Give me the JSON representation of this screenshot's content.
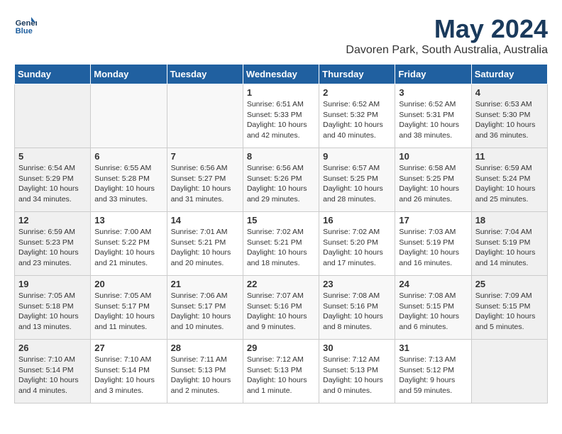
{
  "header": {
    "logo_line1": "General",
    "logo_line2": "Blue",
    "month_title": "May 2024",
    "location": "Davoren Park, South Australia, Australia"
  },
  "weekdays": [
    "Sunday",
    "Monday",
    "Tuesday",
    "Wednesday",
    "Thursday",
    "Friday",
    "Saturday"
  ],
  "weeks": [
    [
      {
        "day": "",
        "info": ""
      },
      {
        "day": "",
        "info": ""
      },
      {
        "day": "",
        "info": ""
      },
      {
        "day": "1",
        "info": "Sunrise: 6:51 AM\nSunset: 5:33 PM\nDaylight: 10 hours\nand 42 minutes."
      },
      {
        "day": "2",
        "info": "Sunrise: 6:52 AM\nSunset: 5:32 PM\nDaylight: 10 hours\nand 40 minutes."
      },
      {
        "day": "3",
        "info": "Sunrise: 6:52 AM\nSunset: 5:31 PM\nDaylight: 10 hours\nand 38 minutes."
      },
      {
        "day": "4",
        "info": "Sunrise: 6:53 AM\nSunset: 5:30 PM\nDaylight: 10 hours\nand 36 minutes."
      }
    ],
    [
      {
        "day": "5",
        "info": "Sunrise: 6:54 AM\nSunset: 5:29 PM\nDaylight: 10 hours\nand 34 minutes."
      },
      {
        "day": "6",
        "info": "Sunrise: 6:55 AM\nSunset: 5:28 PM\nDaylight: 10 hours\nand 33 minutes."
      },
      {
        "day": "7",
        "info": "Sunrise: 6:56 AM\nSunset: 5:27 PM\nDaylight: 10 hours\nand 31 minutes."
      },
      {
        "day": "8",
        "info": "Sunrise: 6:56 AM\nSunset: 5:26 PM\nDaylight: 10 hours\nand 29 minutes."
      },
      {
        "day": "9",
        "info": "Sunrise: 6:57 AM\nSunset: 5:25 PM\nDaylight: 10 hours\nand 28 minutes."
      },
      {
        "day": "10",
        "info": "Sunrise: 6:58 AM\nSunset: 5:25 PM\nDaylight: 10 hours\nand 26 minutes."
      },
      {
        "day": "11",
        "info": "Sunrise: 6:59 AM\nSunset: 5:24 PM\nDaylight: 10 hours\nand 25 minutes."
      }
    ],
    [
      {
        "day": "12",
        "info": "Sunrise: 6:59 AM\nSunset: 5:23 PM\nDaylight: 10 hours\nand 23 minutes."
      },
      {
        "day": "13",
        "info": "Sunrise: 7:00 AM\nSunset: 5:22 PM\nDaylight: 10 hours\nand 21 minutes."
      },
      {
        "day": "14",
        "info": "Sunrise: 7:01 AM\nSunset: 5:21 PM\nDaylight: 10 hours\nand 20 minutes."
      },
      {
        "day": "15",
        "info": "Sunrise: 7:02 AM\nSunset: 5:21 PM\nDaylight: 10 hours\nand 18 minutes."
      },
      {
        "day": "16",
        "info": "Sunrise: 7:02 AM\nSunset: 5:20 PM\nDaylight: 10 hours\nand 17 minutes."
      },
      {
        "day": "17",
        "info": "Sunrise: 7:03 AM\nSunset: 5:19 PM\nDaylight: 10 hours\nand 16 minutes."
      },
      {
        "day": "18",
        "info": "Sunrise: 7:04 AM\nSunset: 5:19 PM\nDaylight: 10 hours\nand 14 minutes."
      }
    ],
    [
      {
        "day": "19",
        "info": "Sunrise: 7:05 AM\nSunset: 5:18 PM\nDaylight: 10 hours\nand 13 minutes."
      },
      {
        "day": "20",
        "info": "Sunrise: 7:05 AM\nSunset: 5:17 PM\nDaylight: 10 hours\nand 11 minutes."
      },
      {
        "day": "21",
        "info": "Sunrise: 7:06 AM\nSunset: 5:17 PM\nDaylight: 10 hours\nand 10 minutes."
      },
      {
        "day": "22",
        "info": "Sunrise: 7:07 AM\nSunset: 5:16 PM\nDaylight: 10 hours\nand 9 minutes."
      },
      {
        "day": "23",
        "info": "Sunrise: 7:08 AM\nSunset: 5:16 PM\nDaylight: 10 hours\nand 8 minutes."
      },
      {
        "day": "24",
        "info": "Sunrise: 7:08 AM\nSunset: 5:15 PM\nDaylight: 10 hours\nand 6 minutes."
      },
      {
        "day": "25",
        "info": "Sunrise: 7:09 AM\nSunset: 5:15 PM\nDaylight: 10 hours\nand 5 minutes."
      }
    ],
    [
      {
        "day": "26",
        "info": "Sunrise: 7:10 AM\nSunset: 5:14 PM\nDaylight: 10 hours\nand 4 minutes."
      },
      {
        "day": "27",
        "info": "Sunrise: 7:10 AM\nSunset: 5:14 PM\nDaylight: 10 hours\nand 3 minutes."
      },
      {
        "day": "28",
        "info": "Sunrise: 7:11 AM\nSunset: 5:13 PM\nDaylight: 10 hours\nand 2 minutes."
      },
      {
        "day": "29",
        "info": "Sunrise: 7:12 AM\nSunset: 5:13 PM\nDaylight: 10 hours\nand 1 minute."
      },
      {
        "day": "30",
        "info": "Sunrise: 7:12 AM\nSunset: 5:13 PM\nDaylight: 10 hours\nand 0 minutes."
      },
      {
        "day": "31",
        "info": "Sunrise: 7:13 AM\nSunset: 5:12 PM\nDaylight: 9 hours\nand 59 minutes."
      },
      {
        "day": "",
        "info": ""
      }
    ]
  ]
}
